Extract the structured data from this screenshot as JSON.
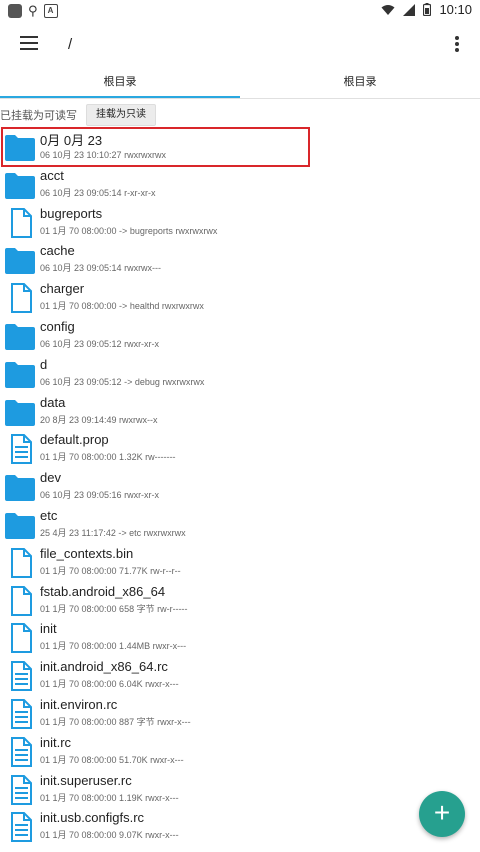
{
  "status_bar": {
    "time": "10:10",
    "icons": [
      "app-icon",
      "bug-icon",
      "notification-a-icon",
      "wifi-icon",
      "signal-icon",
      "battery-icon"
    ]
  },
  "toolbar": {
    "path": "/",
    "menu_icon": "hamburger-menu-icon",
    "more_icon": "more-vert-icon"
  },
  "tabs": [
    {
      "label": "根目录",
      "active": true
    },
    {
      "label": "根目录",
      "active": false
    }
  ],
  "mount": {
    "status": "已挂载为可读写",
    "button_label": "挂载为只读"
  },
  "colors": {
    "accent": "#2aa8e0",
    "folder": "#1e9be0",
    "fab": "#26a08f",
    "highlight": "#d9262a"
  },
  "files": [
    {
      "name": "0月 0月 23",
      "meta": "06 10月 23 10:10:27   rwxrwxrwx",
      "type": "folder"
    },
    {
      "name": "acct",
      "meta": "06 10月 23 09:05:14   r-xr-xr-x",
      "type": "folder"
    },
    {
      "name": "bugreports",
      "meta": "01 1月 70 08:00:00   -> bugreports  rwxrwxrwx",
      "type": "file"
    },
    {
      "name": "cache",
      "meta": "06 10月 23 09:05:14   rwxrwx---",
      "type": "folder"
    },
    {
      "name": "charger",
      "meta": "01 1月 70 08:00:00   -> healthd  rwxrwxrwx",
      "type": "file"
    },
    {
      "name": "config",
      "meta": "06 10月 23 09:05:12   rwxr-xr-x",
      "type": "folder"
    },
    {
      "name": "d",
      "meta": "06 10月 23 09:05:12   -> debug  rwxrwxrwx",
      "type": "folder"
    },
    {
      "name": "data",
      "meta": "20 8月 23 09:14:49   rwxrwx--x",
      "type": "folder"
    },
    {
      "name": "default.prop",
      "meta": "01 1月 70 08:00:00   1.32K  rw-------",
      "type": "doc"
    },
    {
      "name": "dev",
      "meta": "06 10月 23 09:05:16   rwxr-xr-x",
      "type": "folder"
    },
    {
      "name": "etc",
      "meta": "25 4月 23 11:17:42   -> etc  rwxrwxrwx",
      "type": "folder"
    },
    {
      "name": "file_contexts.bin",
      "meta": "01 1月 70 08:00:00   71.77K  rw-r--r--",
      "type": "file"
    },
    {
      "name": "fstab.android_x86_64",
      "meta": "01 1月 70 08:00:00   658 字节  rw-r-----",
      "type": "file"
    },
    {
      "name": "init",
      "meta": "01 1月 70 08:00:00   1.44MB  rwxr-x---",
      "type": "file"
    },
    {
      "name": "init.android_x86_64.rc",
      "meta": "01 1月 70 08:00:00   6.04K  rwxr-x---",
      "type": "doc"
    },
    {
      "name": "init.environ.rc",
      "meta": "01 1月 70 08:00:00   887 字节  rwxr-x---",
      "type": "doc"
    },
    {
      "name": "init.rc",
      "meta": "01 1月 70 08:00:00   51.70K  rwxr-x---",
      "type": "doc"
    },
    {
      "name": "init.superuser.rc",
      "meta": "01 1月 70 08:00:00   1.19K  rwxr-x---",
      "type": "doc"
    },
    {
      "name": "init.usb.configfs.rc",
      "meta": "01 1月 70 08:00:00   9.07K  rwxr-x---",
      "type": "doc"
    }
  ],
  "fab": {
    "label": "+",
    "icon": "add-icon"
  }
}
